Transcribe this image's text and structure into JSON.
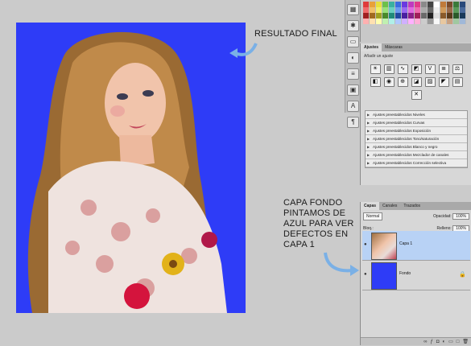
{
  "annotations": {
    "result_label": "RESULTADO FINAL",
    "layer_note": "CAPA FONDO PINTAMOS DE AZUL PARA VER DEFECTOS EN CAPA 1"
  },
  "colors": {
    "background_fill": "#2e3cf7",
    "arrow": "#7ab0e6",
    "selected_layer": "#b8d2f5"
  },
  "adjustments_panel": {
    "tabs": [
      "Ajustes",
      "Máscaras"
    ],
    "title": "Añadir un ajuste",
    "presets": [
      "Ajustes preestablecidos Niveles",
      "Ajustes preestablecidos Curvas",
      "Ajustes preestablecidos Exposición",
      "Ajustes preestablecidos Tono/saturación",
      "Ajustes preestablecidos Blanco y negro",
      "Ajustes preestablecidos Mezclador de canales",
      "Ajustes preestablecidos Corrección selectiva"
    ]
  },
  "layers_panel": {
    "tabs": [
      "Capas",
      "Canales",
      "Trazados"
    ],
    "blend_mode": "Normal",
    "opacity_label": "Opacidad:",
    "opacity_value": "100%",
    "lock_label": "Bloq.:",
    "fill_label": "Relleno:",
    "fill_value": "100%",
    "layers": [
      {
        "name": "Capa 1",
        "selected": true
      },
      {
        "name": "Fondo",
        "selected": false
      }
    ]
  },
  "icons": [
    "eye-icon",
    "lock-icon",
    "arrow-icon",
    "preset-triangle-icon"
  ]
}
